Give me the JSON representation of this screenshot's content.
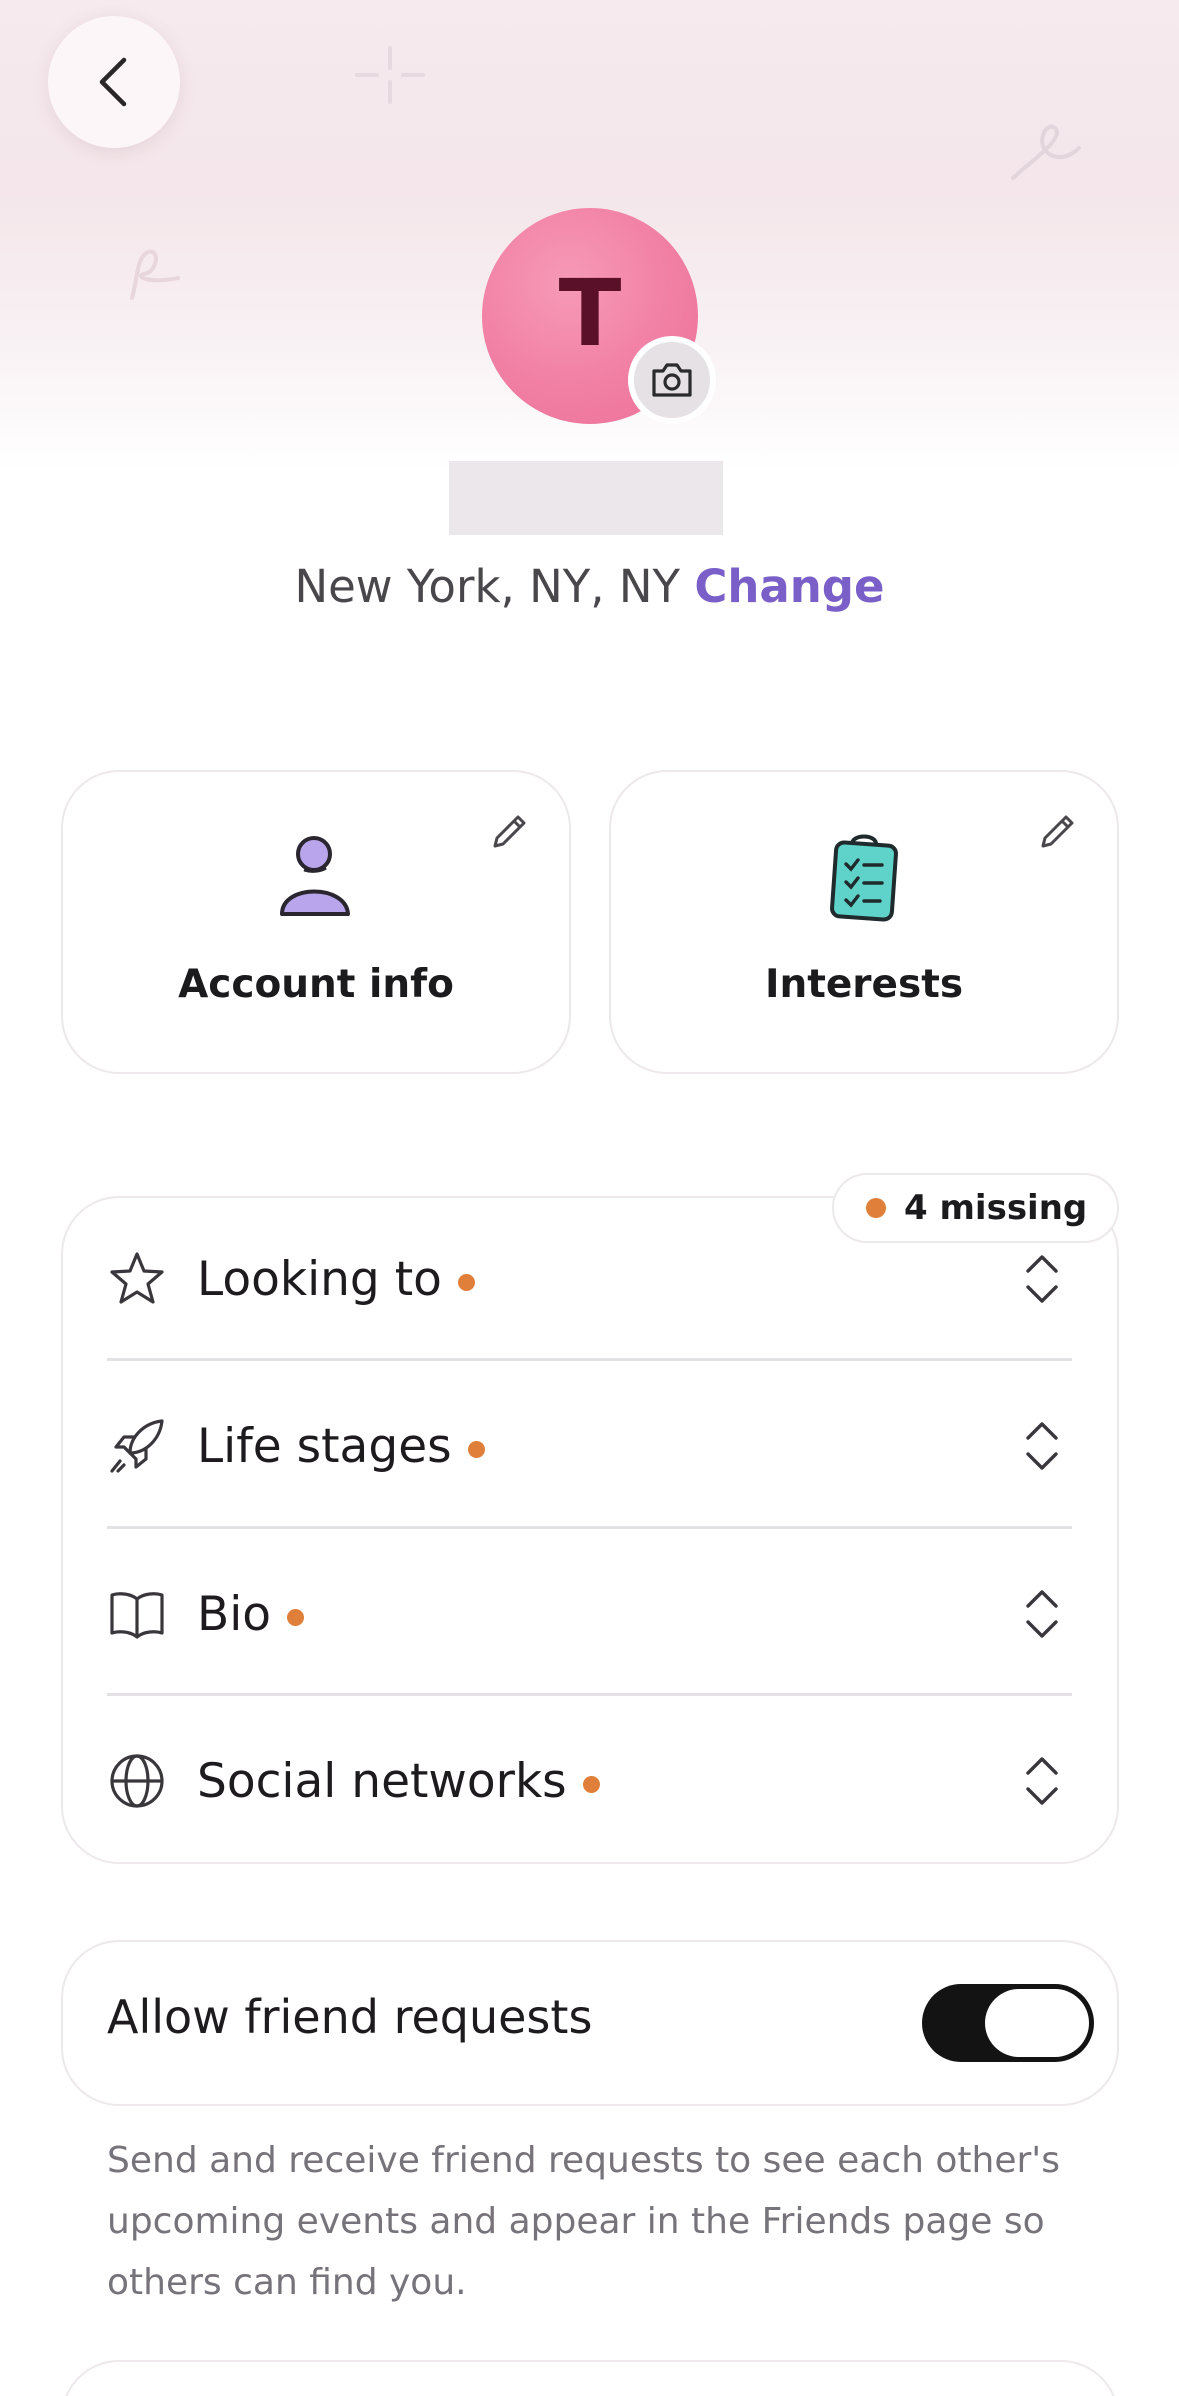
{
  "header": {
    "back_icon": "chevron-left-icon",
    "avatar_initial": "T",
    "camera_icon": "camera-icon"
  },
  "location": {
    "city": "New York, NY, NY",
    "change_label": "Change"
  },
  "cards": [
    {
      "label": "Account info",
      "icon": "person-icon",
      "edit_icon": "pencil-icon"
    },
    {
      "label": "Interests",
      "icon": "clipboard-checklist-icon",
      "edit_icon": "pencil-icon"
    }
  ],
  "profile_sections": {
    "missing_badge": "4 missing",
    "items": [
      {
        "label": "Looking to",
        "icon": "star-icon",
        "incomplete": true
      },
      {
        "label": "Life stages",
        "icon": "rocket-icon",
        "incomplete": true
      },
      {
        "label": "Bio",
        "icon": "book-icon",
        "incomplete": true
      },
      {
        "label": "Social networks",
        "icon": "globe-icon",
        "incomplete": true
      }
    ]
  },
  "friend_requests": {
    "label": "Allow friend requests",
    "enabled": true,
    "description": "Send and receive friend requests to see each other's upcoming events and appear in the Friends page so others can find you."
  },
  "colors": {
    "accent": "#7a5fc8",
    "avatar": "#f17fa4",
    "missing_dot": "#e07f3a",
    "toggle_on": "#141314"
  }
}
